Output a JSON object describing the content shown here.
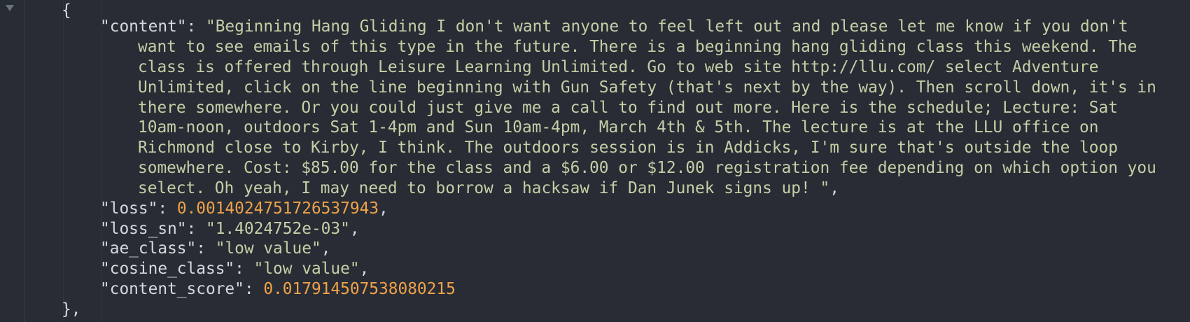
{
  "editor": {
    "open_brace": "{",
    "close_brace": "},",
    "content": {
      "key": "\"content\"",
      "lines": [
        "\"Beginning Hang Gliding I don't want anyone to feel left out and please let me know if you don't",
        "want to see emails of this type in the future. There is a beginning hang gliding class this weekend. The",
        "class is offered through Leisure Learning Unlimited. Go to web site http://llu.com/ select Adventure",
        "Unlimited, click on the line beginning with Gun Safety (that's next by the way). Then scroll down, it's in",
        "there somewhere. Or you could just give me a call to find out more. Here is the schedule; Lecture: Sat",
        "10am-noon, outdoors Sat 1-4pm and Sun 10am-4pm, March 4th & 5th. The lecture is at the LLU office on",
        "Richmond close to Kirby, I think. The outdoors session is in Addicks, I'm sure that's outside the loop",
        "somewhere. Cost: $85.00 for the class and a $6.00 or $12.00 registration fee depending on which option you",
        "select. Oh yeah, I may need to borrow a hacksaw if Dan Junek signs up! \""
      ]
    },
    "loss": {
      "key": "\"loss\"",
      "value": "0.0014024751726537943"
    },
    "loss_sn": {
      "key": "\"loss_sn\"",
      "value": "\"1.4024752e-03\""
    },
    "ae_class": {
      "key": "\"ae_class\"",
      "value": "\"low value\""
    },
    "cosine_class": {
      "key": "\"cosine_class\"",
      "value": "\"low value\""
    },
    "content_score": {
      "key": "\"content_score\"",
      "value": "0.017914507538080215"
    },
    "colors": {
      "background": "#282c34",
      "string": "#c3d0a7",
      "number": "#f0a24b",
      "text": "#d5dadf"
    },
    "icons": [
      "fold-chevron-down-icon"
    ]
  }
}
